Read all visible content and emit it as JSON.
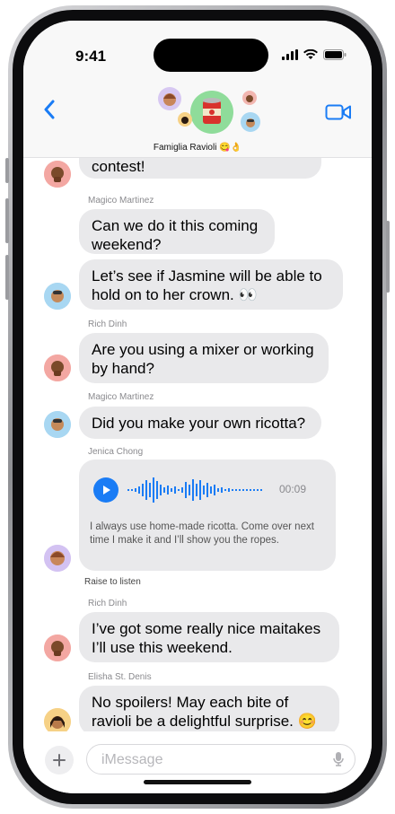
{
  "status_bar": {
    "time": "9:41"
  },
  "header": {
    "group_name": "Famiglia Ravioli 😋👌"
  },
  "messages": [
    {
      "text": "contest!"
    },
    {
      "sender": "Magico Martinez",
      "text_line1": "Can we do it this coming",
      "text_line2": "weekend?"
    },
    {
      "text_line1": "Let’s see if Jasmine will be able to",
      "text_line2": "hold on to her crown. 👀"
    },
    {
      "sender": "Rich Dinh",
      "text_line1": "Are you using a mixer or working",
      "text_line2": "by hand?"
    },
    {
      "sender": "Magico Martinez",
      "text": "Did you make your own ricotta?"
    },
    {
      "sender": "Jenica Chong",
      "duration": "00:09",
      "transcript": "I always use home-made ricotta. Come over next time I make it and I’ll show you the ropes."
    },
    {
      "note": "Raise to listen"
    },
    {
      "sender": "Rich Dinh",
      "text_line1": "I’ve got some really nice maitakes",
      "text_line2": "I’ll use this weekend."
    },
    {
      "sender": "Elisha St. Denis",
      "text_line1": "No spoilers! May each bite of",
      "text_line2": "ravioli be a delightful surprise. 😊"
    }
  ],
  "input": {
    "placeholder": "iMessage"
  },
  "colors": {
    "accent": "#1a7cf5",
    "bubble": "#e9e9eb"
  }
}
